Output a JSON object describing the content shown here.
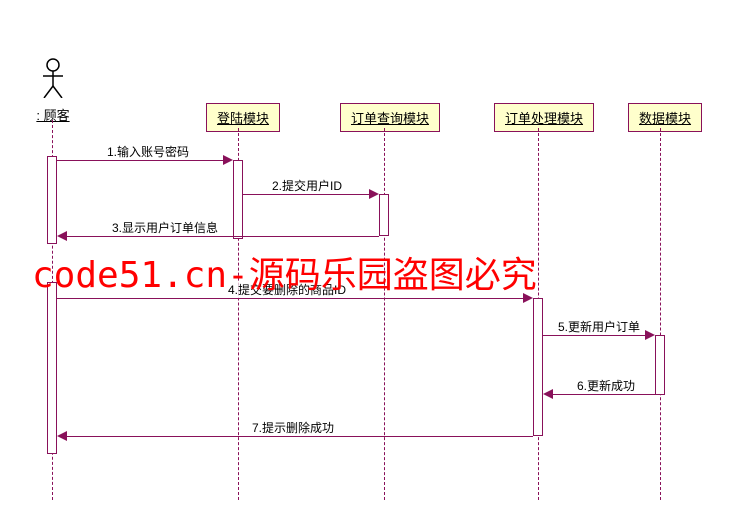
{
  "actor": {
    "label": ": 顾客"
  },
  "participants": {
    "login": {
      "label": "登陆模块"
    },
    "query": {
      "label": "订单查询模块"
    },
    "proc": {
      "label": "订单处理模块"
    },
    "data": {
      "label": "数据模块"
    }
  },
  "messages": {
    "m1": "1.输入账号密码",
    "m2": "2.提交用户ID",
    "m3": "3.显示用户订单信息",
    "m4": "4.提交要删除的商品ID",
    "m5": "5.更新用户订单",
    "m6": "6.更新成功",
    "m7": "7.提示删除成功"
  },
  "watermark": "code51.cn-源码乐园盗图必究",
  "chart_data": {
    "type": "sequence-diagram",
    "actor": "顾客",
    "participants": [
      "登陆模块",
      "订单查询模块",
      "订单处理模块",
      "数据模块"
    ],
    "messages": [
      {
        "from": "顾客",
        "to": "登陆模块",
        "label": "1.输入账号密码",
        "direction": "forward"
      },
      {
        "from": "登陆模块",
        "to": "订单查询模块",
        "label": "2.提交用户ID",
        "direction": "forward"
      },
      {
        "from": "订单查询模块",
        "to": "顾客",
        "label": "3.显示用户订单信息",
        "direction": "return"
      },
      {
        "from": "顾客",
        "to": "订单处理模块",
        "label": "4.提交要删除的商品ID",
        "direction": "forward"
      },
      {
        "from": "订单处理模块",
        "to": "数据模块",
        "label": "5.更新用户订单",
        "direction": "forward"
      },
      {
        "from": "数据模块",
        "to": "订单处理模块",
        "label": "6.更新成功",
        "direction": "return"
      },
      {
        "from": "订单处理模块",
        "to": "顾客",
        "label": "7.提示删除成功",
        "direction": "return"
      }
    ]
  }
}
